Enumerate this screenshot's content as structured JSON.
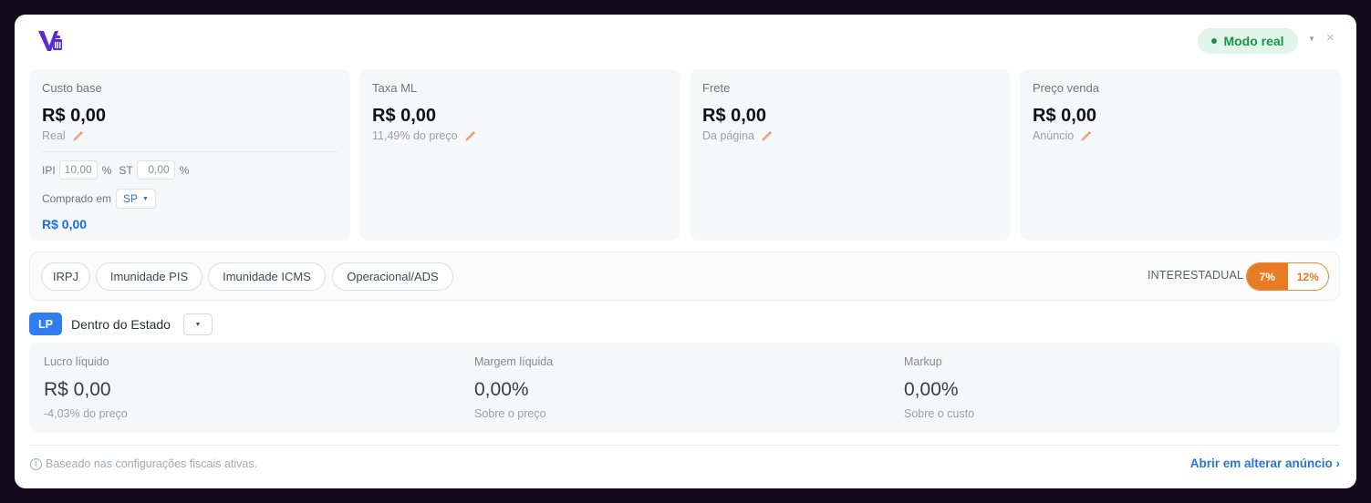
{
  "header": {
    "logo": "vendor-logo-icon",
    "mode_label": "Modo real",
    "caret_icon": "caret-down-icon",
    "close_icon": "close-icon"
  },
  "cards": {
    "custo": {
      "label": "Custo base",
      "value": "R$ 0,00",
      "sub": "Real",
      "ipi_label": "IPI",
      "ipi_value": "10,00",
      "ipi_unit": "%",
      "st_label": "ST",
      "st_value": "0,00",
      "st_unit": "%",
      "bought_label": "Comprado em",
      "bought_uf": "SP",
      "bought_value": "R$ 0,00"
    },
    "taxa": {
      "label": "Taxa ML",
      "value": "R$ 0,00",
      "sub": "11,49% do preço"
    },
    "frete": {
      "label": "Frete",
      "value": "R$ 0,00",
      "sub": "Da página"
    },
    "preco": {
      "label": "Preço venda",
      "value": "R$ 0,00",
      "sub": "Anúncio"
    }
  },
  "chips": {
    "irpj": "IRPJ",
    "pis": "Imunidade PIS",
    "icms": "Imunidade ICMS",
    "ads": "Operacional/ADS"
  },
  "interestadual": {
    "label": "INTERESTADUAL",
    "opt_7": "7%",
    "opt_12": "12%",
    "selected": "7%"
  },
  "regime": {
    "badge": "LP",
    "label": "Dentro do Estado"
  },
  "results": {
    "lucro": {
      "label": "Lucro líquido",
      "value": "R$ 0,00",
      "sub": "-4,03% do preço"
    },
    "margem": {
      "label": "Margem líquida",
      "value": "0,00%",
      "sub": "Sobre o preço"
    },
    "markup": {
      "label": "Markup",
      "value": "0,00%",
      "sub": "Sobre o custo"
    }
  },
  "footer": {
    "info": "Baseado nas configurações fiscais ativas.",
    "link": "Abrir em alterar anúncio ›"
  },
  "colors": {
    "accent_orange": "#e87b24",
    "accent_blue": "#2f7df0",
    "mode_green": "#18924a",
    "logo_purple": "#5b2bd1"
  }
}
